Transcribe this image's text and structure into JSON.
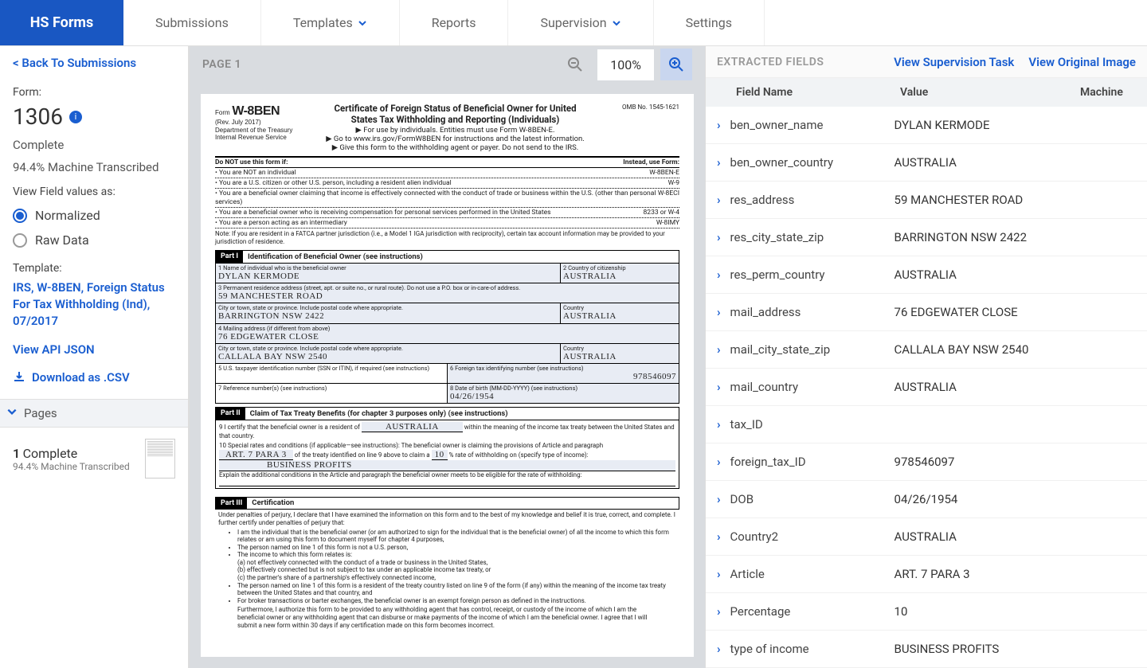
{
  "brand": "HS Forms",
  "nav": {
    "submissions": "Submissions",
    "templates": "Templates",
    "reports": "Reports",
    "supervision": "Supervision",
    "settings": "Settings"
  },
  "sidebar": {
    "back": "< Back To Submissions",
    "form_label": "Form:",
    "form_number": "1306",
    "status": "Complete",
    "machine_pct": "94.4% Machine Transcribed",
    "view_as_label": "View Field values as:",
    "radio_normalized": "Normalized",
    "radio_raw": "Raw Data",
    "template_label": "Template:",
    "template_name": "IRS, W-8BEN, Foreign Status For Tax Withholding (Ind), 07/2017",
    "api_json": "View API JSON",
    "download_csv": "Download as .CSV",
    "pages_header": "Pages",
    "page_entry_num": "1",
    "page_entry_status": "Complete",
    "page_entry_sub": "94.4% Machine Transcribed"
  },
  "center": {
    "page_label": "PAGE 1",
    "zoom": "100%"
  },
  "doc": {
    "form_label": "Form",
    "form_code": "W-8BEN",
    "rev": "(Rev. July 2017)",
    "dept": "Department of the Treasury\nInternal Revenue Service",
    "title1": "Certificate of Foreign Status of Beneficial Owner for United",
    "title2": "States Tax Withholding and Reporting (Individuals)",
    "sub1": "▶ For use by individuals. Entities must use Form W-8BEN-E.",
    "sub2": "▶ Go to www.irs.gov/FormW8BEN for instructions and the latest information.",
    "sub3": "▶ Give this form to the withholding agent or payer. Do not send to the IRS.",
    "omb": "OMB No. 1545-1621",
    "donot": "Do NOT use this form if:",
    "instead": "Instead, use Form:",
    "bullet1_l": "• You are NOT an individual",
    "bullet1_r": "W-8BEN-E",
    "bullet2_l": "• You are a U.S. citizen or other U.S. person, including a resident alien individual",
    "bullet2_r": "W-9",
    "bullet3_l": "• You are a beneficial owner claiming that income is effectively connected with the conduct of trade or business within the U.S. (other than personal services)",
    "bullet3_r": "W-8ECI",
    "bullet4_l": "• You are a beneficial owner who is receiving compensation for personal services performed in the United States",
    "bullet4_r": "8233 or W-4",
    "bullet5_l": "• You are a person acting as an intermediary",
    "bullet5_r": "W-8IMY",
    "note": "Note: If you are resident in a FATCA partner jurisdiction (i.e., a Model 1 IGA jurisdiction with reciprocity), certain tax account information may be provided to your jurisdiction of residence.",
    "part1": "Part I",
    "part1_title": "Identification of Beneficial Owner (see instructions)",
    "f1_label": "1   Name of individual who is the beneficial owner",
    "f1_val": "DYLAN KERMODE",
    "f2_label": "2   Country of citizenship",
    "f2_val": "AUSTRALIA",
    "f3_label": "3   Permanent residence address (street, apt. or suite no., or rural route). Do not use a P.O. box or in-care-of address.",
    "f3_val": "59 MANCHESTER ROAD",
    "f3b_label": "City or town, state or province. Include postal code where appropriate.",
    "f3b_val": "BARRINGTON NSW 2422",
    "f3c_label": "Country",
    "f3c_val": "AUSTRALIA",
    "f4_label": "4   Mailing address (if different from above)",
    "f4_val": "76 EDGEWATER CLOSE",
    "f4b_label": "City or town, state or province. Include postal code where appropriate.",
    "f4b_val": "CALLALA BAY NSW 2540",
    "f4c_label": "Country",
    "f4c_val": "AUSTRALIA",
    "f5_label": "5   U.S. taxpayer identification number (SSN or ITIN), if required (see instructions)",
    "f6_label": "6   Foreign tax identifying number (see instructions)",
    "f6_val": "978546097",
    "f7_label": "7   Reference number(s) (see instructions)",
    "f8_label": "8   Date of birth (MM-DD-YYYY) (see instructions)",
    "f8_val": "04/26/1954",
    "part2": "Part II",
    "part2_title": "Claim of Tax Treaty Benefits (for chapter 3 purposes only) (see instructions)",
    "f9_label": "9   I certify that the beneficial owner is a resident of",
    "f9_val": "AUSTRALIA",
    "f9_tail": "within the meaning of the income tax treaty between the United States and that country.",
    "f10_label": "10   Special rates and conditions (if applicable—see instructions): The beneficial owner is claiming the provisions of Article and paragraph",
    "f10_a": "ART. 7 PARA 3",
    "f10_mid": "of the treaty identified on line 9 above to claim a",
    "f10_pct": "10",
    "f10_tail": "% rate of withholding on (specify type of income):",
    "f10_type": "BUSINESS PROFITS",
    "f10_exp": "Explain the additional conditions in the Article and paragraph the beneficial owner meets to be eligible for the rate of withholding:",
    "part3": "Part III",
    "part3_title": "Certification",
    "cert_intro": "Under penalties of perjury, I declare that I have examined the information on this form and to the best of my knowledge and belief it is true, correct, and complete. I further certify under penalties of perjury that:",
    "cert_b1": "I am the individual that is the beneficial owner (or am authorized to sign for the individual that is the beneficial owner) of all the income to which this form relates or am using this form to document myself for chapter 4 purposes,",
    "cert_b2": "The person named on line 1 of this form is not a U.S. person,",
    "cert_b3": "The income to which this form relates is:",
    "cert_b3a": "(a) not effectively connected with the conduct of a trade or business in the United States,",
    "cert_b3b": "(b) effectively connected but is not subject to tax under an applicable income tax treaty, or",
    "cert_b3c": "(c) the partner's share of a partnership's effectively connected income,",
    "cert_b4": "The person named on line 1 of this form is a resident of the treaty country listed on line 9 of the form (if any) within the meaning of the income tax treaty between the United States and that country, and",
    "cert_b5": "For broker transactions or barter exchanges, the beneficial owner is an exempt foreign person as defined in the instructions.",
    "cert_tail": "Furthermore, I authorize this form to be provided to any withholding agent that has control, receipt, or custody of the income of which I am the beneficial owner or any withholding agent that can disburse or make payments of the income of which I am the beneficial owner. I agree that I will submit a new form within 30 days if any certification made on this form becomes incorrect."
  },
  "extracted": {
    "title": "EXTRACTED FIELDS",
    "view_supervision": "View Supervision Task",
    "view_original": "View Original Image",
    "col_field": "Field Name",
    "col_value": "Value",
    "col_machine": "Machine",
    "rows": [
      {
        "name": "ben_owner_name",
        "value": "DYLAN KERMODE"
      },
      {
        "name": "ben_owner_country",
        "value": "AUSTRALIA"
      },
      {
        "name": "res_address",
        "value": "59 MANCHESTER ROAD"
      },
      {
        "name": "res_city_state_zip",
        "value": "BARRINGTON NSW 2422"
      },
      {
        "name": "res_perm_country",
        "value": "AUSTRALIA"
      },
      {
        "name": "mail_address",
        "value": "76 EDGEWATER CLOSE"
      },
      {
        "name": "mail_city_state_zip",
        "value": "CALLALA BAY NSW 2540"
      },
      {
        "name": "mail_country",
        "value": "AUSTRALIA"
      },
      {
        "name": "tax_ID",
        "value": ""
      },
      {
        "name": "foreign_tax_ID",
        "value": "978546097"
      },
      {
        "name": "DOB",
        "value": "04/26/1954"
      },
      {
        "name": "Country2",
        "value": "AUSTRALIA"
      },
      {
        "name": "Article",
        "value": "ART. 7 PARA 3"
      },
      {
        "name": "Percentage",
        "value": "10"
      },
      {
        "name": "type of income",
        "value": "BUSINESS PROFITS"
      }
    ]
  }
}
